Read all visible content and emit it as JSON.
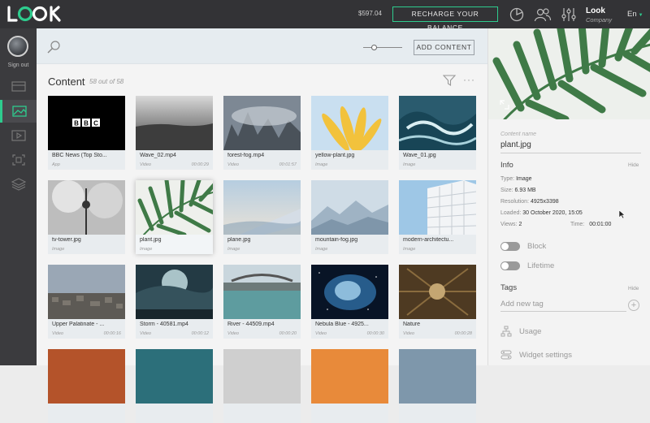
{
  "topbar": {
    "balance": "$597.04",
    "recharge_label": "RECHARGE YOUR BALANCE",
    "company_name": "Look",
    "company_role": "Company",
    "language": "En",
    "accent_color": "#2ecc8e"
  },
  "sidebar": {
    "signout_label": "Sign out",
    "items": [
      {
        "icon": "screen-icon",
        "active": false
      },
      {
        "icon": "image-gallery-icon",
        "active": true
      },
      {
        "icon": "video-icon",
        "active": false
      },
      {
        "icon": "scan-icon",
        "active": false
      },
      {
        "icon": "layers-icon",
        "active": false
      }
    ]
  },
  "toolbar": {
    "add_content_label": "ADD CONTENT"
  },
  "content": {
    "title": "Content",
    "count": "58 out of 58",
    "items": [
      {
        "name": "BBC News (Top Sto...",
        "type": "App",
        "duration": "",
        "thumb": "bbc"
      },
      {
        "name": "Wave_02.mp4",
        "type": "Video",
        "duration": "00:00:29",
        "thumb": "sea"
      },
      {
        "name": "forest-fog.mp4",
        "type": "Video",
        "duration": "00:01:57",
        "thumb": "fog"
      },
      {
        "name": "yellow-plant.jpg",
        "type": "Image",
        "duration": "",
        "thumb": "yellow"
      },
      {
        "name": "Wave_01.jpg",
        "type": "Image",
        "duration": "",
        "thumb": "wave"
      },
      {
        "name": "tv-tower.jpg",
        "type": "Image",
        "duration": "",
        "thumb": "tower"
      },
      {
        "name": "plant.jpg",
        "type": "Image",
        "duration": "",
        "thumb": "plant",
        "selected": true
      },
      {
        "name": "plane.jpg",
        "type": "Image",
        "duration": "",
        "thumb": "plane"
      },
      {
        "name": "mountain-fog.jpg",
        "type": "Image",
        "duration": "",
        "thumb": "mountain"
      },
      {
        "name": "modern-architectu...",
        "type": "Image",
        "duration": "",
        "thumb": "arch"
      },
      {
        "name": "Upper Palatinate - ...",
        "type": "Video",
        "duration": "00:00:16",
        "thumb": "city"
      },
      {
        "name": "Storm - 40581.mp4",
        "type": "Video",
        "duration": "00:00:12",
        "thumb": "storm"
      },
      {
        "name": "River - 44509.mp4",
        "type": "Video",
        "duration": "00:00:20",
        "thumb": "river"
      },
      {
        "name": "Nebula Blue - 4925...",
        "type": "Video",
        "duration": "00:00:30",
        "thumb": "nebula"
      },
      {
        "name": "Nature",
        "type": "Video",
        "duration": "00:00:28",
        "thumb": "nature"
      }
    ]
  },
  "panel": {
    "content_name_label": "Content name",
    "content_name": "plant.jpg",
    "info_title": "Info",
    "hide_label": "Hide",
    "type_label": "Type:",
    "type_value": "Image",
    "size_label": "Size:",
    "size_value": "6.93 MB",
    "resolution_label": "Resolution:",
    "resolution_value": "4925x3398",
    "loaded_label": "Loaded:",
    "loaded_value": "30 October 2020, 15:05",
    "views_label": "Views:",
    "views_value": "2",
    "time_label": "Time:",
    "time_value": "00:01:00",
    "block_label": "Block",
    "lifetime_label": "Lifetime",
    "tags_title": "Tags",
    "tags_hide_label": "Hide",
    "tag_placeholder": "Add new tag",
    "usage_label": "Usage",
    "widget_label": "Widget settings"
  }
}
